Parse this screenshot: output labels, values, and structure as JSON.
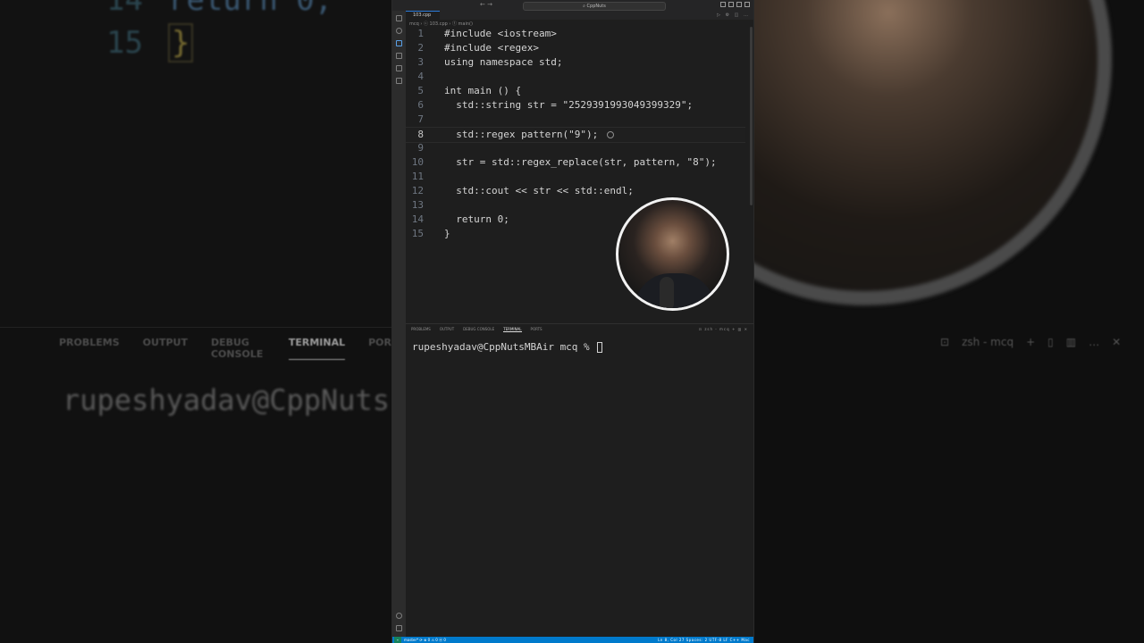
{
  "window": {
    "title": "CppNuts",
    "nav": "← →"
  },
  "tab": {
    "label": "103.cpp"
  },
  "breadcrumb": "mcq › ⓒ 103.cpp › ⓕ main()",
  "editor": {
    "lines": [
      {
        "num": "1",
        "code": "#include <iostream>"
      },
      {
        "num": "2",
        "code": "#include <regex>"
      },
      {
        "num": "3",
        "code": "using namespace std;"
      },
      {
        "num": "4",
        "code": ""
      },
      {
        "num": "5",
        "code": "int main () {"
      },
      {
        "num": "6",
        "code": "  std::string str = \"2529391993049399329\";"
      },
      {
        "num": "7",
        "code": ""
      },
      {
        "num": "8",
        "code": "  std::regex pattern(\"9\");"
      },
      {
        "num": "9",
        "code": ""
      },
      {
        "num": "10",
        "code": "  str = std::regex_replace(str, pattern, \"8\");"
      },
      {
        "num": "11",
        "code": ""
      },
      {
        "num": "12",
        "code": "  std::cout << str << std::endl;"
      },
      {
        "num": "13",
        "code": ""
      },
      {
        "num": "14",
        "code": "  return 0;"
      },
      {
        "num": "15",
        "code": "}"
      }
    ]
  },
  "panel": {
    "tabs": [
      "PROBLEMS",
      "OUTPUT",
      "DEBUG CONSOLE",
      "TERMINAL",
      "PORTS"
    ],
    "active_tab": "TERMINAL",
    "shell_label": "zsh - mcq",
    "prompt": "rupeshyadav@CppNutsMBAir mcq % "
  },
  "background": {
    "line14_num": "14",
    "line14_code": "return 0;",
    "line15_num": "15",
    "line15_code": "}",
    "tabs": [
      "PROBLEMS",
      "OUTPUT",
      "DEBUG CONSOLE",
      "TERMINAL",
      "POR"
    ],
    "terminal_text": "rupeshyadav@CppNuts",
    "shell_label": "zsh - mcq"
  },
  "statusbar": {
    "left": "master* ⟳  ⊗ 0 ⚠ 0  ⓦ 0",
    "right": "Ln 8, Col 27   Spaces: 2   UTF-8   LF   C++   Mac"
  }
}
